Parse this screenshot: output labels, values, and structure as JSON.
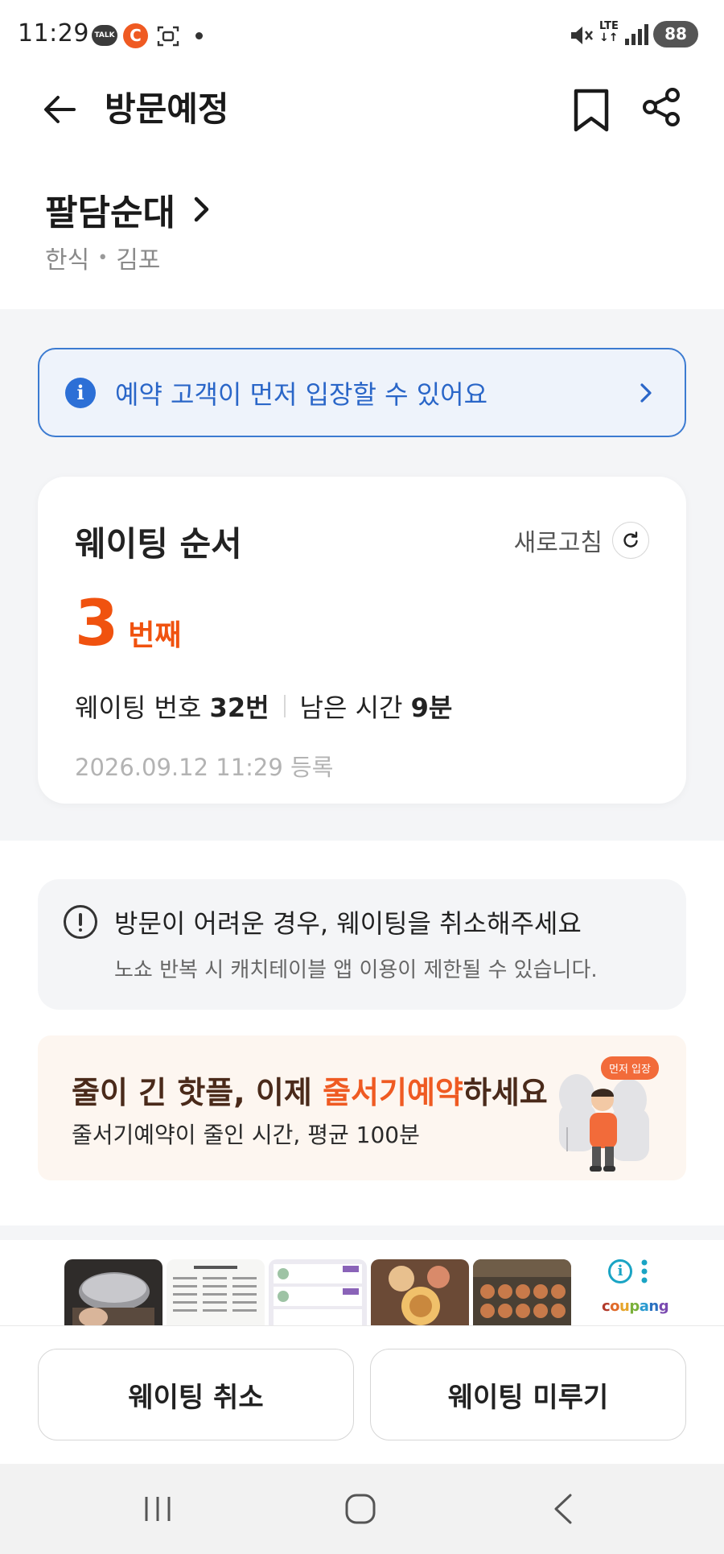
{
  "status_bar": {
    "time": "11:29",
    "talk_icon": "TALK",
    "c_icon": "C",
    "lte": "LTE",
    "battery": "88"
  },
  "header": {
    "title": "방문예정",
    "icons": {
      "back": "arrow-left-icon",
      "bookmark": "bookmark-icon",
      "share": "share-icon"
    }
  },
  "restaurant": {
    "name": "팔담순대",
    "category": "한식",
    "separator": "•",
    "location": "김포"
  },
  "info_banner": {
    "text": "예약 고객이 먼저 입장할 수 있어요",
    "icon": "i",
    "color": "#2c6fd6"
  },
  "waiting": {
    "title": "웨이팅 순서",
    "refresh_label": "새로고침",
    "order_number": "3",
    "order_unit": "번째",
    "number_label": "웨이팅 번호",
    "number_value": "32번",
    "remaining_label": "남은 시간",
    "remaining_value": "9분",
    "registered_at": "2026.09.12 11:29 등록",
    "accent_color": "#f0520f"
  },
  "notice": {
    "title": "방문이 어려운 경우, 웨이팅을 취소해주세요",
    "subtitle": "노쇼 반복 시 캐치테이블 앱 이용이 제한될 수 있습니다."
  },
  "promo": {
    "title_prefix": "줄이 긴 핫플, 이제 ",
    "title_highlight": "줄서기예약",
    "title_suffix": "하세요",
    "subtitle": "줄서기예약이 줄인 시간, 평균 100분",
    "badge": "먼저 입장"
  },
  "ad": {
    "brand": "coupang",
    "info_icon": "i"
  },
  "actions": {
    "cancel": "웨이팅 취소",
    "postpone": "웨이팅 미루기"
  },
  "nav": {
    "recent": "recent-apps-icon",
    "home": "home-icon",
    "back": "back-icon"
  }
}
